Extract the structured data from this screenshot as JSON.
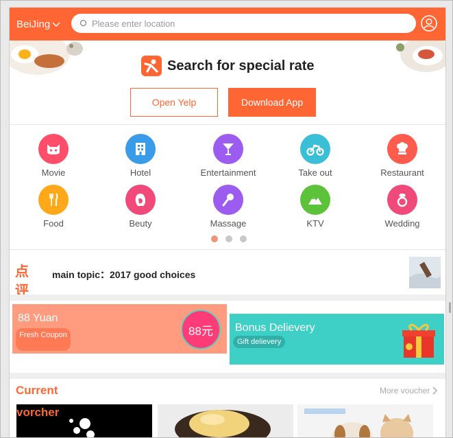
{
  "header": {
    "city": "BeiJing",
    "search_placeholder": "Please enter location"
  },
  "promo": {
    "title": "Search for special rate",
    "open_label": "Open Yelp",
    "download_label": "Download App"
  },
  "categories": [
    {
      "label": "Movie",
      "color": "#ff4d6a",
      "icon": "cat-icon"
    },
    {
      "label": "Hotel",
      "color": "#3a9be8",
      "icon": "hotel-icon"
    },
    {
      "label": "Entertainment",
      "color": "#9d5cf0",
      "icon": "cocktail-icon"
    },
    {
      "label": "Take out",
      "color": "#3bbfd6",
      "icon": "bike-icon"
    },
    {
      "label": "Restaurant",
      "color": "#ff5c4d",
      "icon": "chef-icon"
    },
    {
      "label": "Food",
      "color": "#ffa81a",
      "icon": "fork-knife-icon"
    },
    {
      "label": "Beuty",
      "color": "#f04a7a",
      "icon": "woman-face-icon"
    },
    {
      "label": "Massage",
      "color": "#9d5cf0",
      "icon": "microphone-icon"
    },
    {
      "label": "KTV",
      "color": "#5cc23a",
      "icon": "mountain-icon"
    },
    {
      "label": "Wedding",
      "color": "#f04a7a",
      "icon": "ring-icon"
    }
  ],
  "topic": {
    "logo_text": "点评",
    "text": "main topic：2017 good choices"
  },
  "coupons": {
    "left_amount": "88 Yuan",
    "left_pill": "Fresh Coupon",
    "left_badge": "88元",
    "right_title": "Bonus Delievery",
    "right_pill": "Gift delievery"
  },
  "current": {
    "title": "Current",
    "more_label": "More voucher",
    "thumb1_text": "vorcher"
  },
  "colors": {
    "accent": "#ff6633"
  }
}
